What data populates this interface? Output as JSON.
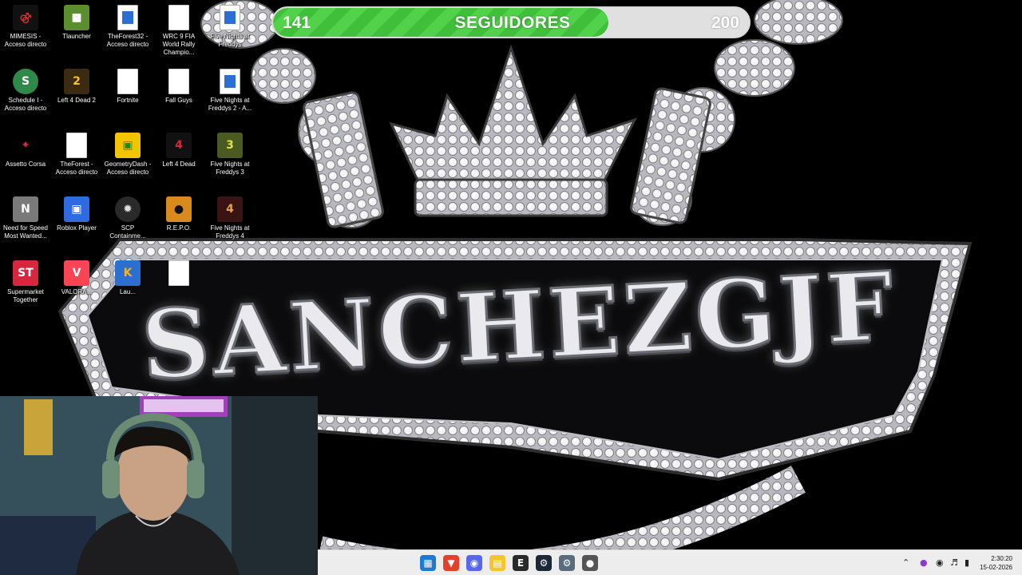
{
  "goal": {
    "current": "141",
    "target": "200",
    "label": "SEGUIDORES",
    "progress_fraction": 0.705,
    "fill_color": "#46c640"
  },
  "wallpaper": {
    "logo_text": "SANCHEZGJF"
  },
  "desktop_icons": [
    {
      "label": "MIMESIS - Acceso directo",
      "icon": "mimesis-icon"
    },
    {
      "label": "Tlauncher",
      "icon": "tlauncher-icon"
    },
    {
      "label": "TheForest32 - Acceso directo",
      "icon": "shortcut-icon"
    },
    {
      "label": "WRC 9 FIA World Rally Champio...",
      "icon": "file-icon"
    },
    {
      "label": "Five Nights at Freddys",
      "icon": "shortcut-icon"
    },
    {
      "label": "Schedule I - Acceso directo",
      "icon": "schedule-i-icon"
    },
    {
      "label": "Left 4 Dead 2",
      "icon": "left4dead2-icon"
    },
    {
      "label": "Fortnite",
      "icon": "file-icon"
    },
    {
      "label": "Fall Guys",
      "icon": "file-icon"
    },
    {
      "label": "Five Nights at Freddys 2 - A...",
      "icon": "shortcut-icon"
    },
    {
      "label": "Assetto Corsa",
      "icon": "assetto-corsa-icon"
    },
    {
      "label": "TheForest - Acceso directo",
      "icon": "file-icon"
    },
    {
      "label": "GeometryDash - Acceso directo",
      "icon": "geometry-dash-icon"
    },
    {
      "label": "Left 4 Dead",
      "icon": "left4dead-icon"
    },
    {
      "label": "Five Nights at Freddys 3",
      "icon": "fnaf3-icon"
    },
    {
      "label": "Need for Speed Most Wanted...",
      "icon": "need-for-speed-icon"
    },
    {
      "label": "Roblox Player",
      "icon": "roblox-icon"
    },
    {
      "label": "SCP Containme...",
      "icon": "scp-icon"
    },
    {
      "label": "R.E.P.O.",
      "icon": "repo-icon"
    },
    {
      "label": "Five Nights at Freddys 4",
      "icon": "fnaf4-icon"
    },
    {
      "label": "Supermarket Together",
      "icon": "supermarket-together-icon"
    },
    {
      "label": "VALORA...",
      "icon": "valorant-icon"
    },
    {
      "label": "Lau...",
      "icon": "launcher-icon"
    },
    {
      "label": "",
      "icon": "file-icon"
    }
  ],
  "taskbar": {
    "apps": [
      {
        "name": "windows-start",
        "color": "#1e78d8"
      },
      {
        "name": "brave-browser",
        "color": "#e2422b"
      },
      {
        "name": "discord",
        "color": "#5865f2"
      },
      {
        "name": "file-explorer",
        "color": "#f4c431"
      },
      {
        "name": "epic-games",
        "color": "#2a2a2a"
      },
      {
        "name": "steam",
        "color": "#1b2838"
      },
      {
        "name": "settings",
        "color": "#5a6b7d"
      },
      {
        "name": "recorder",
        "color": "#555555"
      }
    ],
    "clock": {
      "time": "2:30:20",
      "date": "15-02-2026"
    }
  }
}
